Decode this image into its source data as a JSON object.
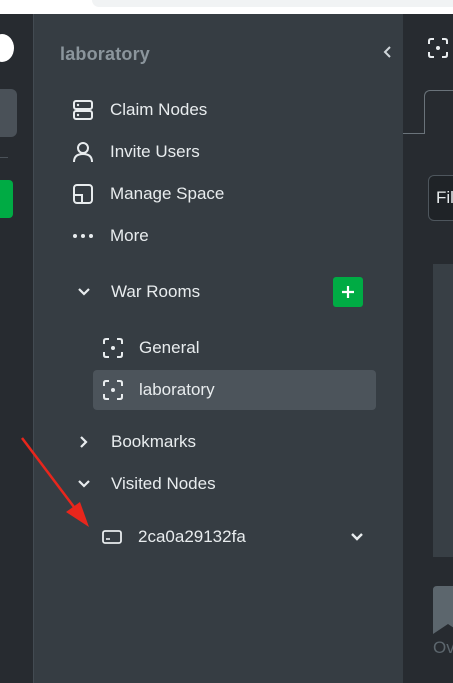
{
  "sidebar": {
    "space_title": "laboratory",
    "nav": [
      {
        "label": "Claim Nodes",
        "icon": "nodes-server-icon"
      },
      {
        "label": "Invite Users",
        "icon": "user-icon"
      },
      {
        "label": "Manage Space",
        "icon": "manage-space-icon"
      },
      {
        "label": "More",
        "icon": "more-dots-icon"
      }
    ],
    "war_rooms": {
      "label": "War Rooms",
      "rooms": [
        {
          "label": "General",
          "active": false
        },
        {
          "label": "laboratory",
          "active": true
        }
      ]
    },
    "bookmarks": {
      "label": "Bookmarks"
    },
    "visited_nodes": {
      "label": "Visited Nodes",
      "nodes": [
        {
          "label": "2ca0a29132fa"
        }
      ]
    }
  },
  "content": {
    "filter_text": "Fil",
    "bottom_tab_text": "Ov"
  },
  "colors": {
    "accent_green": "#00ab44",
    "annotation_red": "#e8261c"
  }
}
